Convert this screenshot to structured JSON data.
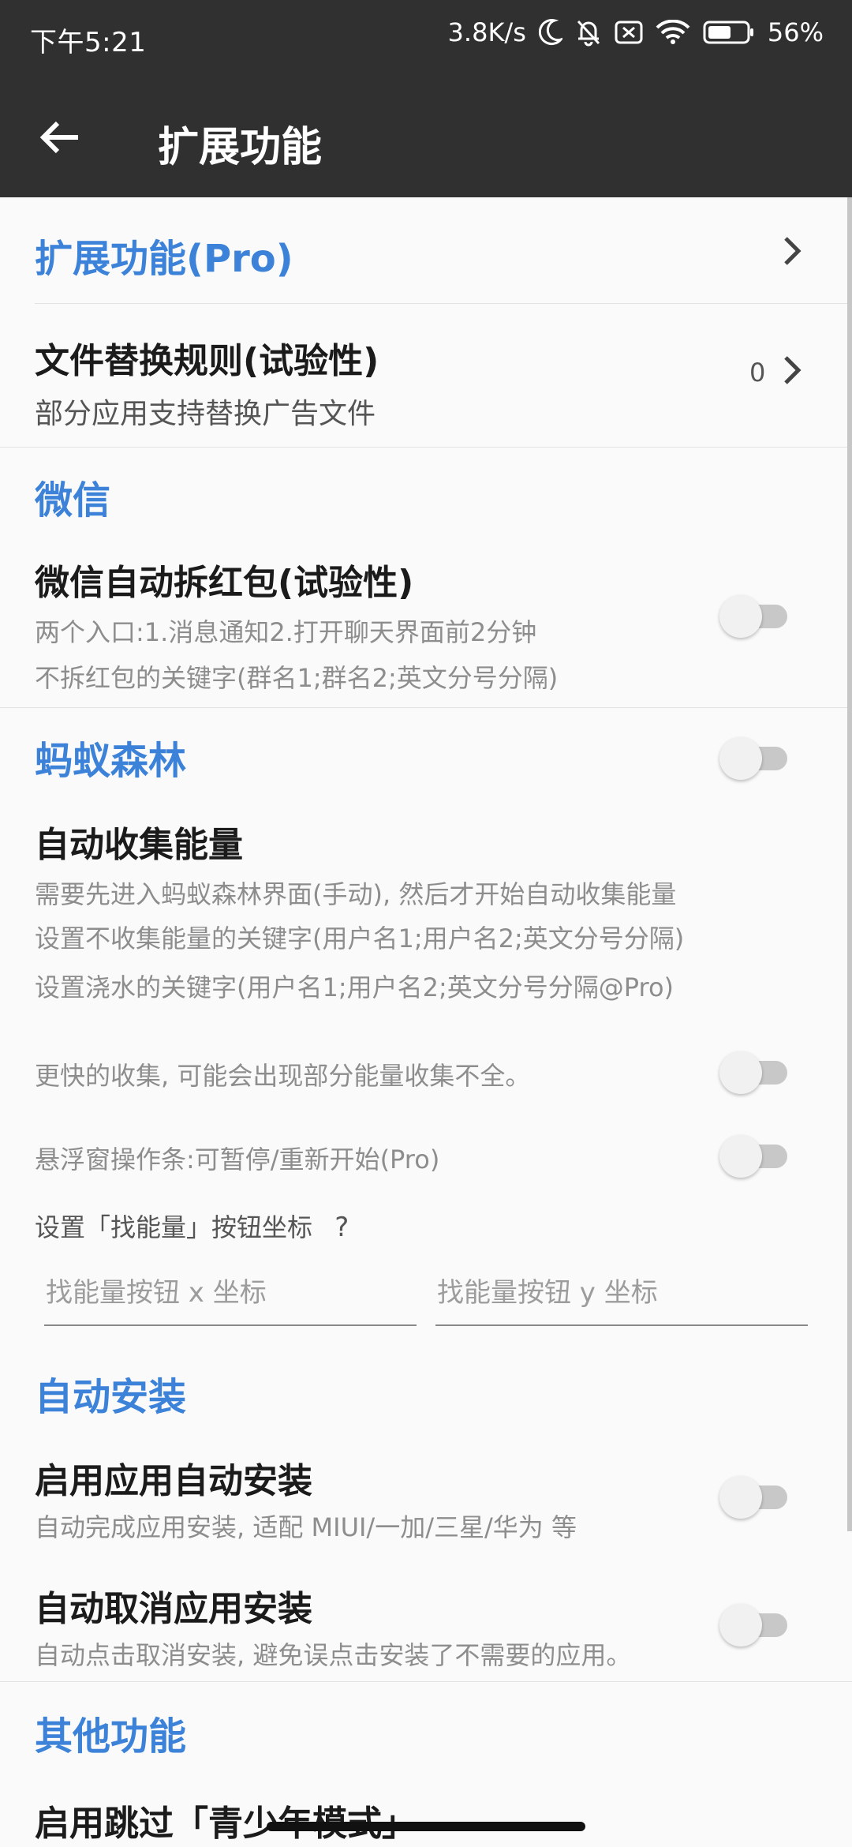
{
  "status_bar": {
    "time": "下午5:21",
    "net_speed": "3.8K/s",
    "battery": "56%",
    "icons": [
      "moon-icon",
      "bell-off-icon",
      "sim-off-icon",
      "wifi-icon",
      "battery-icon"
    ]
  },
  "app_bar": {
    "title": "扩展功能",
    "back_icon": "arrow-left-icon"
  },
  "sections": {
    "pro": {
      "label": "扩展功能(Pro)"
    },
    "file_replace": {
      "title": "文件替换规则(试验性)",
      "subtitle": "部分应用支持替换广告文件",
      "count": "0"
    },
    "wechat": {
      "header": "微信",
      "redpacket_title": "微信自动拆红包(试验性)",
      "redpacket_desc1": "两个入口:1.消息通知2.打开聊天界面前2分钟",
      "redpacket_desc2": "不拆红包的关键字(群名1;群名2;英文分号分隔)",
      "redpacket_enabled": false
    },
    "ant_forest": {
      "header": "蚂蚁森林",
      "header_enabled": false,
      "collect_title": "自动收集能量",
      "collect_desc1": "需要先进入蚂蚁森林界面(手动), 然后才开始自动收集能量",
      "collect_desc2": "设置不收集能量的关键字(用户名1;用户名2;英文分号分隔)",
      "water_desc": "设置浇水的关键字(用户名1;用户名2;英文分号分隔@Pro)",
      "faster_desc": "更快的收集, 可能会出现部分能量收集不全。",
      "faster_enabled": false,
      "float_desc": "悬浮窗操作条:可暂停/重新开始(Pro)",
      "float_enabled": false,
      "coord_label": "设置「找能量」按钮坐标",
      "coord_help": "?",
      "x_placeholder": "找能量按钮 x 坐标",
      "y_placeholder": "找能量按钮 y 坐标"
    },
    "auto_install": {
      "header": "自动安装",
      "enable_title": "启用应用自动安装",
      "enable_desc": "自动完成应用安装, 适配 MIUI/一加/三星/华为 等",
      "enable_enabled": false,
      "cancel_title": "自动取消应用安装",
      "cancel_desc": "自动点击取消安装, 避免误点击安装了不需要的应用。",
      "cancel_enabled": false
    },
    "other": {
      "header": "其他功能",
      "teen_title": "启用跳过「青少年模式」"
    }
  },
  "colors": {
    "app_bar": "#303030",
    "accent_blue": "#3b82d8",
    "background": "#fafafa"
  }
}
